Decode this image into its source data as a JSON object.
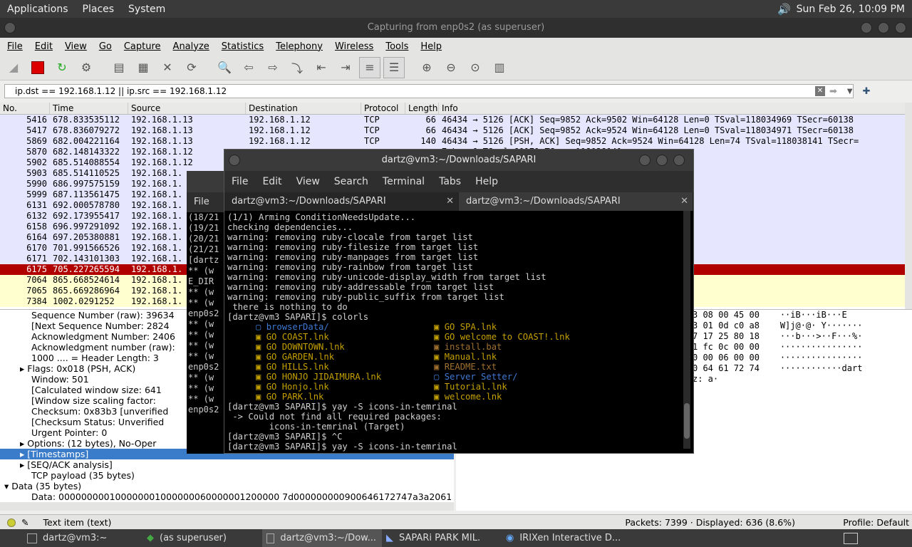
{
  "top_panel": {
    "menus": [
      "Applications",
      "Places",
      "System"
    ],
    "clock": "Sun Feb 26, 10:09 PM"
  },
  "wireshark": {
    "title": "Capturing from enp0s2 (as superuser)",
    "menus": [
      "File",
      "Edit",
      "View",
      "Go",
      "Capture",
      "Analyze",
      "Statistics",
      "Telephony",
      "Wireless",
      "Tools",
      "Help"
    ],
    "filter": "ip.dst == 192.168.1.12 || ip.src == 192.168.1.12",
    "columns": [
      "No.",
      "Time",
      "Source",
      "Destination",
      "Protocol",
      "Length",
      "Info"
    ],
    "packets": [
      {
        "no": "5416",
        "time": "678.833535112",
        "src": "192.168.1.13",
        "dst": "192.168.1.12",
        "proto": "TCP",
        "len": "66",
        "info": "46434 → 5126 [ACK] Seq=9852 Ack=9502 Win=64128 Len=0 TSval=118034969 TSecr=60138"
      },
      {
        "no": "5417",
        "time": "678.836079272",
        "src": "192.168.1.13",
        "dst": "192.168.1.12",
        "proto": "TCP",
        "len": "66",
        "info": "46434 → 5126 [ACK] Seq=9852 Ack=9524 Win=64128 Len=0 TSval=118034971 TSecr=60138"
      },
      {
        "no": "5869",
        "time": "682.004221164",
        "src": "192.168.1.13",
        "dst": "192.168.1.12",
        "proto": "TCP",
        "len": "140",
        "info": "46434 → 5126 [PSH, ACK] Seq=9852 Ack=9524 Win=64128 Len=74 TSval=118038141 TSecr="
      },
      {
        "no": "5870",
        "time": "682.148143322",
        "src": "192.168.1.12",
        "dst": "",
        "proto": "",
        "len": "",
        "info": "7 Len=0 TSval=60171 TSecr=118038141"
      },
      {
        "no": "5902",
        "time": "685.514088554",
        "src": "192.168.1.12",
        "dst": "",
        "proto": "",
        "len": "",
        "info": "=64647 Len=18 TSval=60202 TSecr=1180"
      },
      {
        "no": "5903",
        "time": "685.514110525",
        "src": "192.168.1.",
        "dst": "",
        "proto": "",
        "len": "",
        "info": "3 Len=0 TSval=118041651 TSecr=60202"
      },
      {
        "no": "5990",
        "time": "686.997575159",
        "src": "192.168.1.",
        "dst": "",
        "proto": "",
        "len": "",
        "info": "=64128 Len=74 TSval=118043135 TSecr"
      },
      {
        "no": "5999",
        "time": "687.113561475",
        "src": "192.168.1.",
        "dst": "",
        "proto": "",
        "len": "",
        "info": "73 Len=0 TSval=60217 TSecr=118043135"
      },
      {
        "no": "6131",
        "time": "692.000578780",
        "src": "192.168.1.",
        "dst": "",
        "proto": "",
        "len": "",
        "info": "=64128 Len=74 TSval=118048138 TSecr"
      },
      {
        "no": "6132",
        "time": "692.173955417",
        "src": "192.168.1.",
        "dst": "",
        "proto": "",
        "len": "",
        "info": "99 Len=0 TSval=60267 TSecr=118048138"
      },
      {
        "no": "6158",
        "time": "696.997291092",
        "src": "192.168.1.",
        "dst": "",
        "proto": "",
        "len": "",
        "info": "=64128 Len=74 TSval=118053134 TSecr"
      },
      {
        "no": "6164",
        "time": "697.205380881",
        "src": "192.168.1.",
        "dst": "",
        "proto": "",
        "len": "",
        "info": "25 Len=0 TSval=60318 TSecr=118053134"
      },
      {
        "no": "6170",
        "time": "701.991566526",
        "src": "192.168.1.",
        "dst": "",
        "proto": "",
        "len": "",
        "info": "=64128 Len=74 TSval=118058129 TSecr"
      },
      {
        "no": "6171",
        "time": "702.143101303",
        "src": "192.168.1.",
        "dst": "",
        "proto": "",
        "len": "",
        "info": "51 Len=0 TSval=60367 TSecr=118058129"
      },
      {
        "no": "6175",
        "time": "705.227265594",
        "src": "192.168.1.",
        "dst": "",
        "proto": "",
        "len": "",
        "info": "=0 Len=0"
      },
      {
        "no": "7064",
        "time": "865.668524614",
        "src": "192.168.1.",
        "dst": "",
        "proto": "",
        "len": "",
        "info": ""
      },
      {
        "no": "7065",
        "time": "865.669286964",
        "src": "192.168.1.",
        "dst": "",
        "proto": "",
        "len": "",
        "info": ""
      },
      {
        "no": "7384",
        "time": "1002.0291252",
        "src": "192.168.1.",
        "dst": "",
        "proto": "",
        "len": "",
        "info": "erver  NT Workstation  Potential Bro"
      }
    ],
    "details": [
      {
        "indent": 1,
        "text": "Sequence Number (raw): 39634"
      },
      {
        "indent": 1,
        "text": "[Next Sequence Number: 2824"
      },
      {
        "indent": 1,
        "text": "Acknowledgment Number: 2406"
      },
      {
        "indent": 1,
        "text": "Acknowledgment number (raw):"
      },
      {
        "indent": 1,
        "text": "1000 .... = Header Length: 3"
      },
      {
        "indent": 0,
        "text": "▸ Flags: 0x018 (PSH, ACK)"
      },
      {
        "indent": 1,
        "text": "Window: 501"
      },
      {
        "indent": 1,
        "text": "[Calculated window size: 641"
      },
      {
        "indent": 1,
        "text": "[Window size scaling factor:"
      },
      {
        "indent": 1,
        "text": "Checksum: 0x83b3 [unverified"
      },
      {
        "indent": 1,
        "text": "[Checksum Status: Unverified"
      },
      {
        "indent": 1,
        "text": "Urgent Pointer: 0"
      },
      {
        "indent": 0,
        "text": "▸ Options: (12 bytes), No-Oper"
      },
      {
        "indent": 0,
        "text": "▸ [Timestamps]",
        "selected": true
      },
      {
        "indent": 0,
        "text": "▸ [SEQ/ACK analysis]"
      },
      {
        "indent": 1,
        "text": "TCP payload (35 bytes)"
      },
      {
        "indent": -1,
        "text": "▾ Data (35 bytes)"
      },
      {
        "indent": 1,
        "text": "Data: 000000000100000001000000060000001200000 7d000000000900646172747a3a2061"
      }
    ],
    "hex": [
      "3 08 00 45 00    ··iB···iB···E",
      "3 01 0d c0 a8    W]j@·@· Y·······",
      "7 17 25 80 18    ···b···>··F···%·",
      "1 fc 0c 00 00    ················",
      "0 00 06 00 00    ················",
      "0 64 61 72 74    ············dart",
      "z: a·"
    ],
    "status": {
      "item": "Text item (text)",
      "counts": "Packets: 7399 · Displayed: 636 (8.6%)",
      "profile": "Profile: Default"
    }
  },
  "terminal_back": {
    "menu": "File",
    "lines": [
      "(18/21",
      "(19/21",
      "(20/21",
      "(21/21",
      "[dartz",
      " ** (w",
      "E_DIR ",
      " ** (w",
      " ** (w",
      "enp0s2",
      " ** (w",
      " ** (w",
      " ** (w",
      " ** (w",
      "enp0s2",
      " ** (w",
      " ** (w",
      " ** (w",
      "enp0s2"
    ]
  },
  "terminal": {
    "title": "dartz@vm3:~/Downloads/SAPARI",
    "menus": [
      "File",
      "Edit",
      "View",
      "Search",
      "Terminal",
      "Tabs",
      "Help"
    ],
    "tabs": [
      "dartz@vm3:~/Downloads/SAPARI",
      "dartz@vm3:~/Downloads/SAPARI"
    ],
    "lines_before": [
      "(1/1) Arming ConditionNeedsUpdate...",
      "checking dependencies...",
      "warning: removing ruby-clocale from target list",
      "warning: removing ruby-filesize from target list",
      "warning: removing ruby-manpages from target list",
      "warning: removing ruby-rainbow from target list",
      "warning: removing ruby-unicode-display_width from target list",
      "warning: removing ruby-addressable from target list",
      "warning: removing ruby-public_suffix from target list",
      " there is nothing to do",
      "[dartz@vm3 SAPARI]$ colorls"
    ],
    "files_left": [
      {
        "name": "browserData/",
        "color": "bl"
      },
      {
        "name": "GO COAST.lnk",
        "color": "yw"
      },
      {
        "name": "GO DOWNTOWN.lnk",
        "color": "yw"
      },
      {
        "name": "GO GARDEN.lnk",
        "color": "yw"
      },
      {
        "name": "GO HILLS.lnk",
        "color": "yw"
      },
      {
        "name": "GO HONJO JIDAIMURA.lnk",
        "color": "yw"
      },
      {
        "name": "GO Honjo.lnk",
        "color": "yw"
      },
      {
        "name": "GO PARK.lnk",
        "color": "yw"
      }
    ],
    "files_right": [
      {
        "name": "GO SPA.lnk",
        "color": "yw"
      },
      {
        "name": "GO welcome to COAST!.lnk",
        "color": "yw"
      },
      {
        "name": "install.bat",
        "color": "or"
      },
      {
        "name": "Manual.lnk",
        "color": "yw"
      },
      {
        "name": "README.txt",
        "color": "or"
      },
      {
        "name": "Server Setter/",
        "color": "bl"
      },
      {
        "name": "Tutorial.lnk",
        "color": "yw"
      },
      {
        "name": "welcome.lnk",
        "color": "yw"
      }
    ],
    "lines_after": [
      "[dartz@vm3 SAPARI]$ yay -S icons-in-temrinal",
      " -> Could not find all required packages:",
      "        icons-in-temrinal (Target)",
      "[dartz@vm3 SAPARI]$ ^C",
      "[dartz@vm3 SAPARI]$ yay -S icons-in-temrinal"
    ]
  },
  "taskbar": {
    "tasks": [
      "dartz@vm3:~",
      "(as superuser)",
      "dartz@vm3:~/Dow...",
      "SAPARi PARK MIL.",
      "IRIXen Interactive D..."
    ]
  }
}
